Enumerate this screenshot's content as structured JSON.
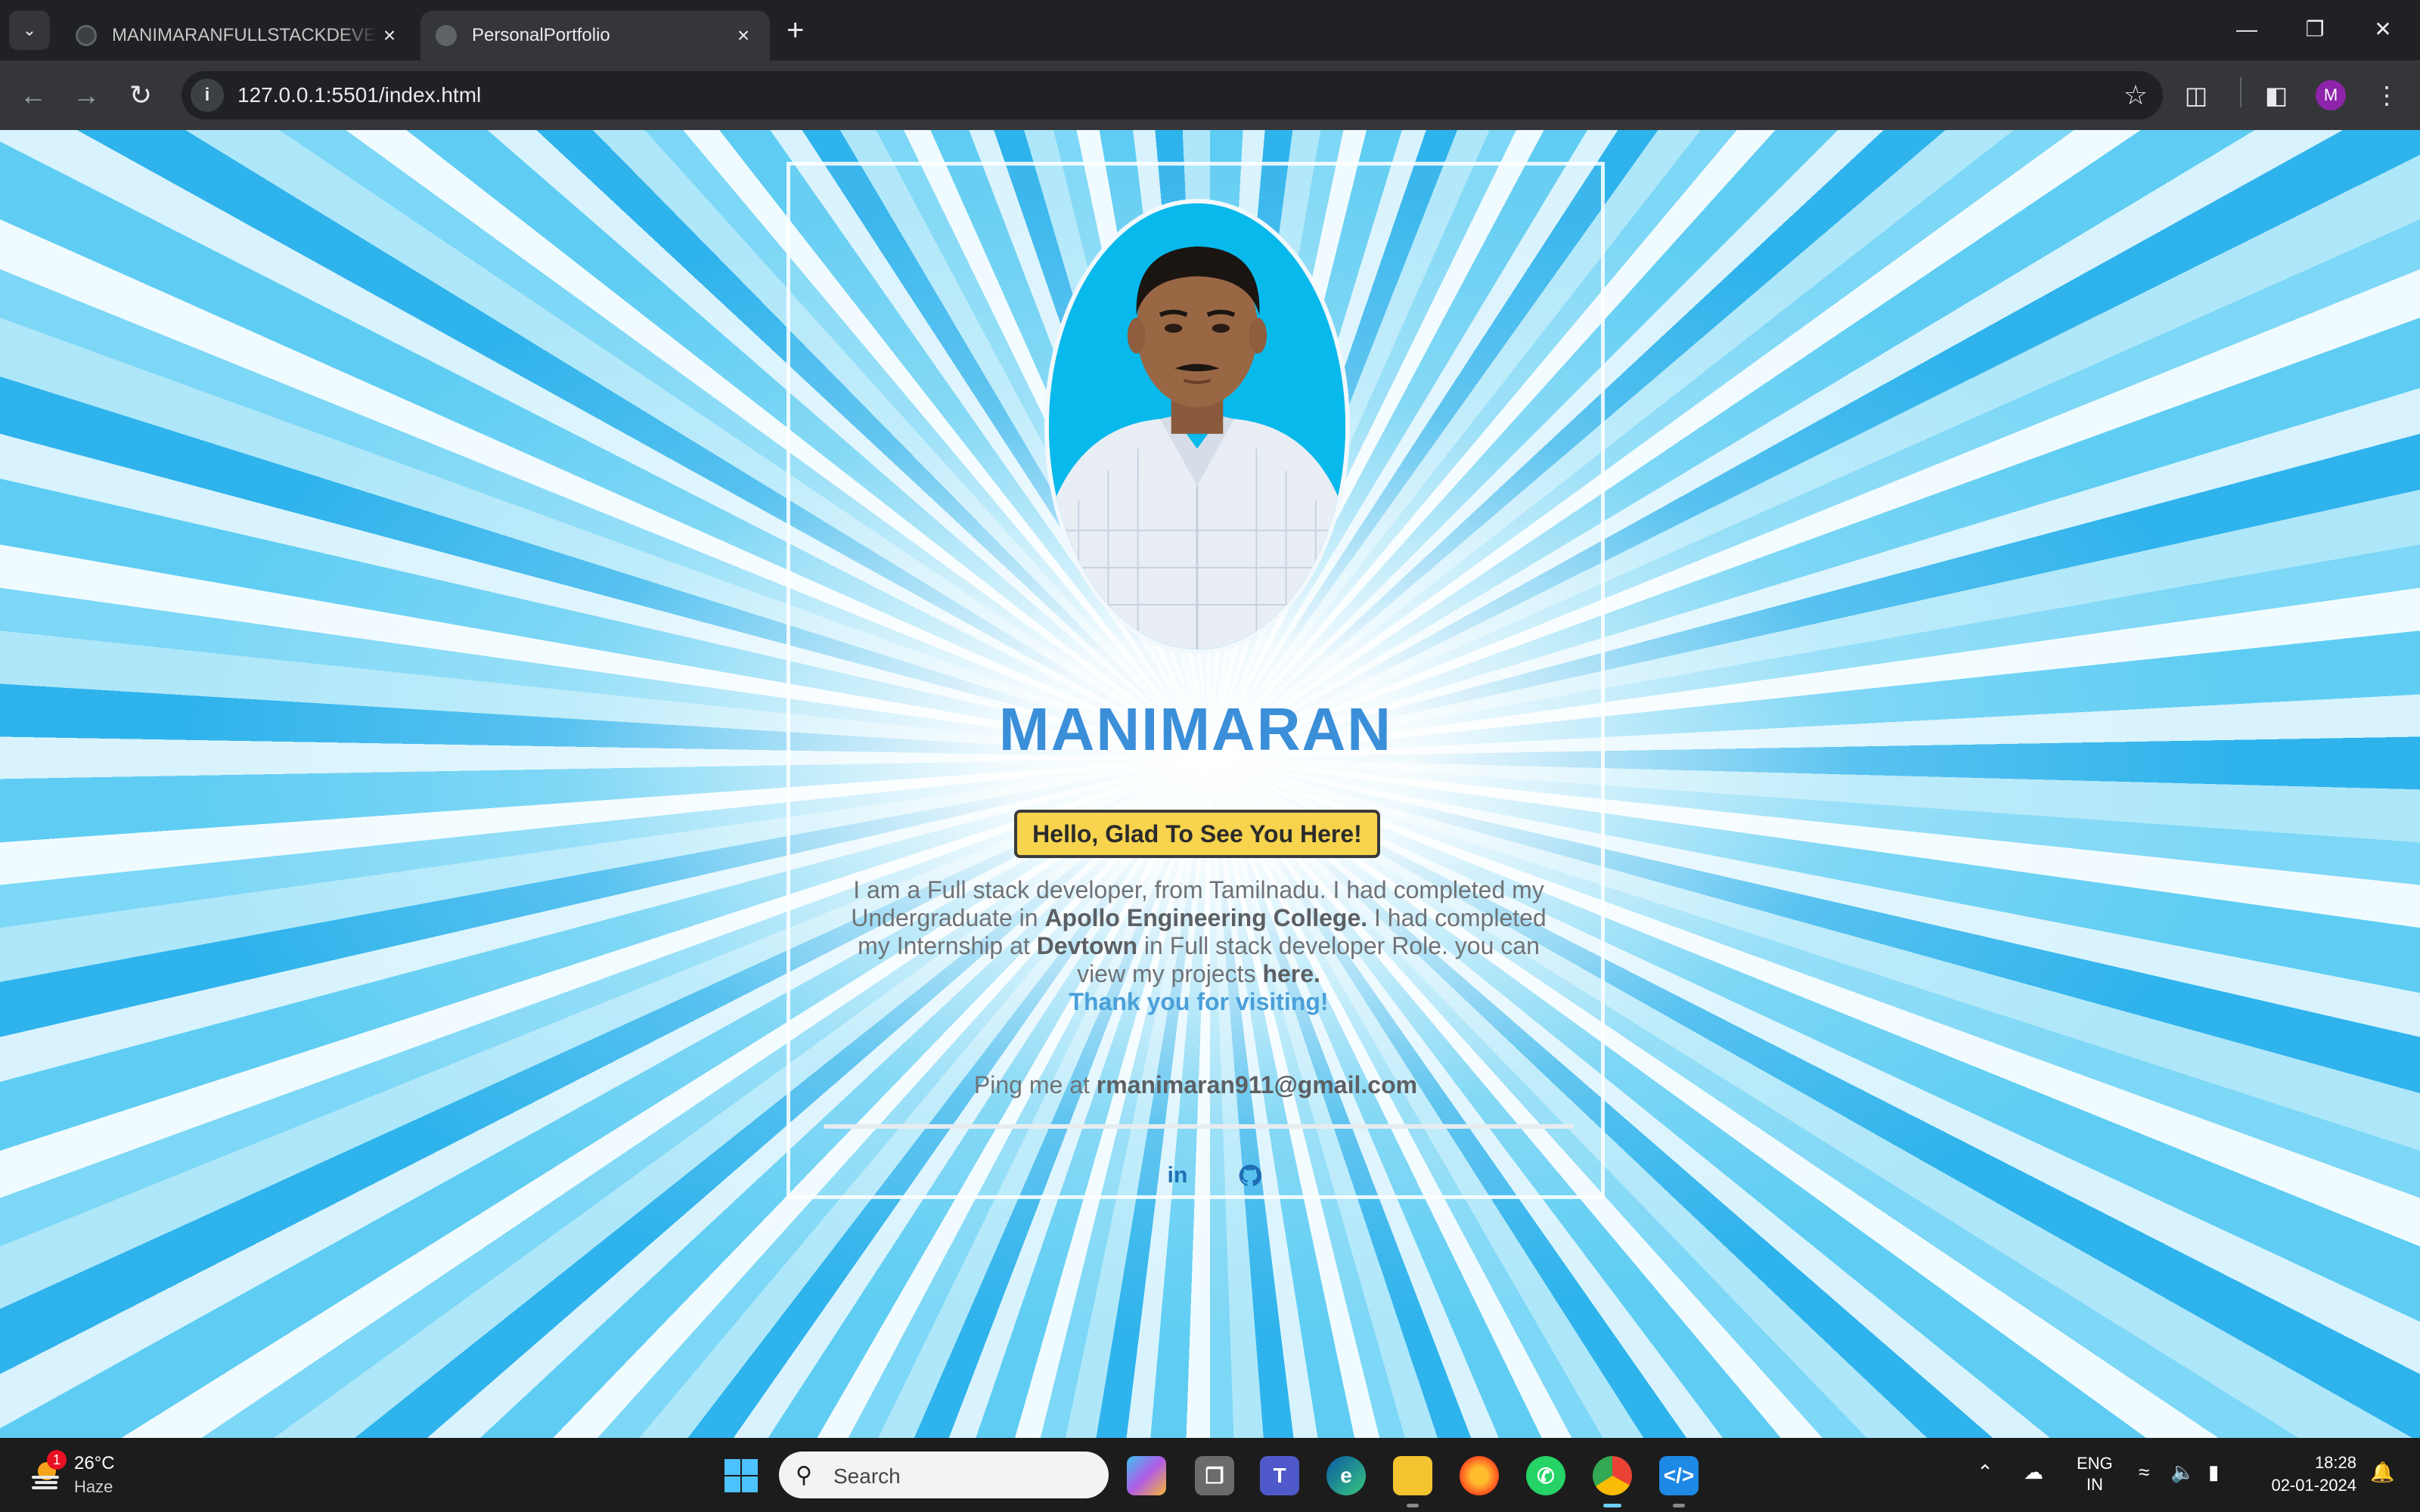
{
  "browser": {
    "tabs": [
      {
        "title": "MANIMARANFULLSTACKDEVELOPER",
        "active": false
      },
      {
        "title": "PersonalPortfolio",
        "active": true
      }
    ],
    "url": "127.0.0.1:5501/index.html",
    "profile_initial": "M"
  },
  "portfolio": {
    "name": "MANIMARAN",
    "greeting_button": "Hello, Glad To See You Here!",
    "bio": {
      "part1": "I am a Full stack developer, from Tamilnadu. I had completed my Undergraduate in ",
      "college": "Apollo Engineering College.",
      "part2": " I had completed my Internship at ",
      "company": "Devtown",
      "part3": " in Full stack developer Role. you can view my projects ",
      "projects_link": "here."
    },
    "thanks": "Thank you for visiting!",
    "ping_prefix": "Ping me at ",
    "email": "rmanimaran911@gmail.com",
    "social": {
      "linkedin": "in",
      "github": "github"
    }
  },
  "taskbar": {
    "weather_temp": "26°C",
    "weather_desc": "Haze",
    "weather_badge": "1",
    "search_placeholder": "Search",
    "language_line1": "ENG",
    "language_line2": "IN",
    "time": "18:28",
    "date": "02-01-2024"
  },
  "colors": {
    "name_blue": "#3b8fd9",
    "button_yellow": "#f7d34e",
    "thanks_blue": "#4b9fd9",
    "sky_blue": "#08b9ec"
  }
}
